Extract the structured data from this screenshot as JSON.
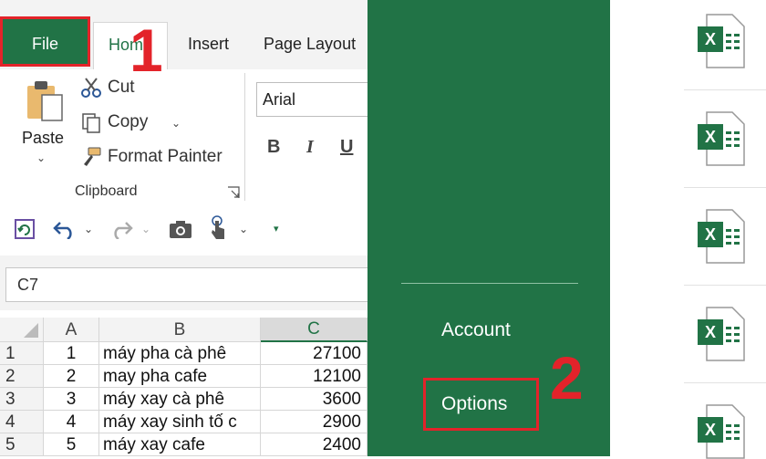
{
  "tabs": {
    "file": "File",
    "home": "Home",
    "insert": "Insert",
    "page_layout": "Page Layout"
  },
  "clipboard": {
    "paste": "Paste",
    "cut": "Cut",
    "copy": "Copy",
    "format_painter": "Format Painter",
    "group_label": "Clipboard"
  },
  "font": {
    "name": "Arial",
    "bold": "B",
    "italic": "I",
    "underline": "U"
  },
  "name_box": "C7",
  "grid": {
    "columns": [
      "A",
      "B",
      "C"
    ],
    "active_column": "C",
    "rows": [
      {
        "n": "1",
        "a": "1",
        "b": "máy pha cà phê",
        "c": "27100"
      },
      {
        "n": "2",
        "a": "2",
        "b": "may pha cafe",
        "c": "12100"
      },
      {
        "n": "3",
        "a": "3",
        "b": "máy xay cà phê",
        "c": "3600"
      },
      {
        "n": "4",
        "a": "4",
        "b": "máy xay sinh tố c",
        "c": "2900"
      },
      {
        "n": "5",
        "a": "5",
        "b": "máy xay cafe",
        "c": "2400"
      }
    ]
  },
  "backstage": {
    "account": "Account",
    "options": "Options"
  },
  "annotations": {
    "step1": "1",
    "step2": "2"
  },
  "icons": [
    "paste-icon",
    "cut-icon",
    "copy-icon",
    "format-painter-icon",
    "dialog-launcher-icon",
    "autosave-icon",
    "undo-icon",
    "redo-icon",
    "camera-icon",
    "touch-mode-icon",
    "customize-qat-icon",
    "excel-file-icon"
  ],
  "colors": {
    "excel_green": "#217346",
    "annotation_red": "#e3232a"
  }
}
